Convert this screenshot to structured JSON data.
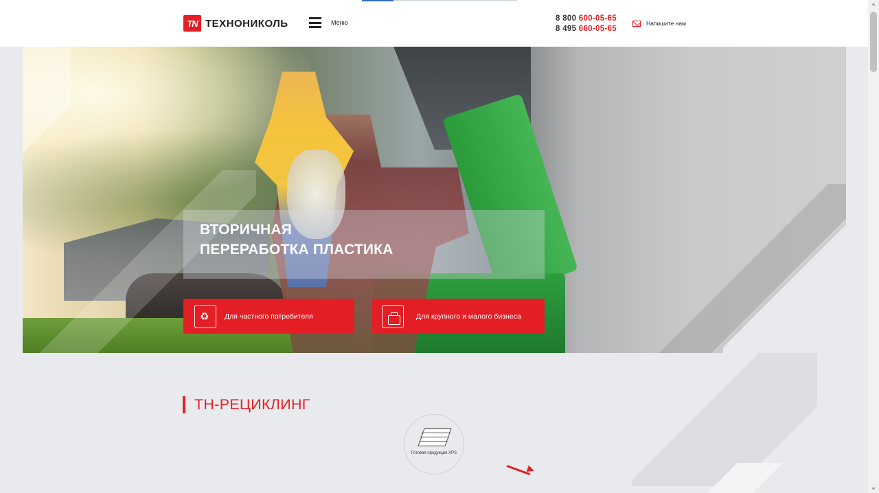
{
  "header": {
    "logo_mark": "TN",
    "logo_text": "ТЕХНОНИКОЛЬ",
    "menu_label": "Меню",
    "phones": [
      {
        "prefix": "8 800 ",
        "number": "600-05-65"
      },
      {
        "prefix": "8 495 ",
        "number": "660-05-65"
      }
    ],
    "write_us": "Напишите нам"
  },
  "hero": {
    "title_line1": "Вторичная",
    "title_line2": "переработка пластика",
    "buttons": [
      {
        "label": "Для частного потребителя",
        "icon": "recycle-bin-icon"
      },
      {
        "label": "Для крупного и малого бизнеса",
        "icon": "documents-briefcase-icon"
      }
    ]
  },
  "section": {
    "title": "ТН-РЕЦИКЛИНГ",
    "product_label": "Готовая продукция XPS"
  },
  "colors": {
    "accent": "#e31e24",
    "background": "#e9eaed"
  }
}
